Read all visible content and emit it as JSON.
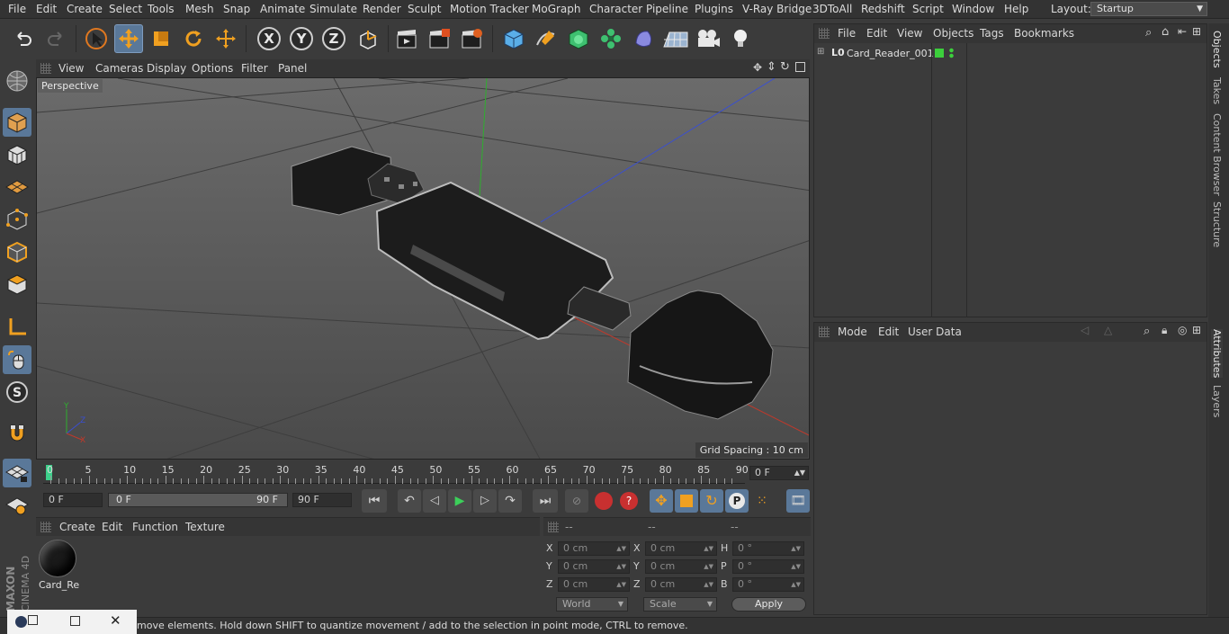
{
  "menu": {
    "items": [
      "File",
      "Edit",
      "Create",
      "Select",
      "Tools",
      "Mesh",
      "Snap",
      "Animate",
      "Simulate",
      "Render",
      "Sculpt",
      "Motion Tracker",
      "MoGraph",
      "Character",
      "Pipeline",
      "Plugins",
      "V-Ray Bridge",
      "3DToAll",
      "Redshift",
      "Script",
      "Window",
      "Help"
    ],
    "layout_label": "Layout:",
    "layout_value": "Startup"
  },
  "viewport": {
    "menu": [
      "View",
      "Cameras",
      "Display",
      "Options",
      "Filter",
      "Panel"
    ],
    "name": "Perspective",
    "grid_spacing": "Grid Spacing : 10 cm"
  },
  "timeline": {
    "ticks": [
      "0",
      "5",
      "10",
      "15",
      "20",
      "25",
      "30",
      "35",
      "40",
      "45",
      "50",
      "55",
      "60",
      "65",
      "70",
      "75",
      "80",
      "85",
      "90"
    ],
    "current_frame": "0 F"
  },
  "transport": {
    "start": "0 F",
    "range_start": "0 F",
    "range_end": "90 F",
    "end": "90 F"
  },
  "material_manager": {
    "menu": [
      "Create",
      "Edit",
      "Function",
      "Texture"
    ],
    "material_label": "Card_Re"
  },
  "coords": {
    "headers": [
      "--",
      "--",
      "--"
    ],
    "rows": [
      {
        "a": "X",
        "av": "0 cm",
        "b": "X",
        "bv": "0 cm",
        "c": "H",
        "cv": "0 °"
      },
      {
        "a": "Y",
        "av": "0 cm",
        "b": "Y",
        "bv": "0 cm",
        "c": "P",
        "cv": "0 °"
      },
      {
        "a": "Z",
        "av": "0 cm",
        "b": "Z",
        "bv": "0 cm",
        "c": "B",
        "cv": "0 °"
      }
    ],
    "space": "World",
    "mode": "Scale",
    "apply": "Apply"
  },
  "object_manager": {
    "menu": [
      "File",
      "Edit",
      "View",
      "Objects",
      "Tags",
      "Bookmarks"
    ],
    "object_name": "Card_Reader_001"
  },
  "attributes": {
    "menu": [
      "Mode",
      "Edit",
      "User Data"
    ]
  },
  "right_tabs": [
    "Objects",
    "Takes",
    "Content Browser",
    "Structure",
    "Attributes",
    "Layers"
  ],
  "status": "move elements. Hold down SHIFT to quantize movement / add to the selection in point mode, CTRL to remove.",
  "brand": {
    "line1": "MAXON",
    "line2": "CINEMA 4D"
  },
  "colors": {
    "accent": "#5a7899",
    "object_green": "#3ccf3c",
    "axis_x": "#c0392b",
    "axis_y": "#2fae2f",
    "axis_z": "#3a4fd0"
  }
}
